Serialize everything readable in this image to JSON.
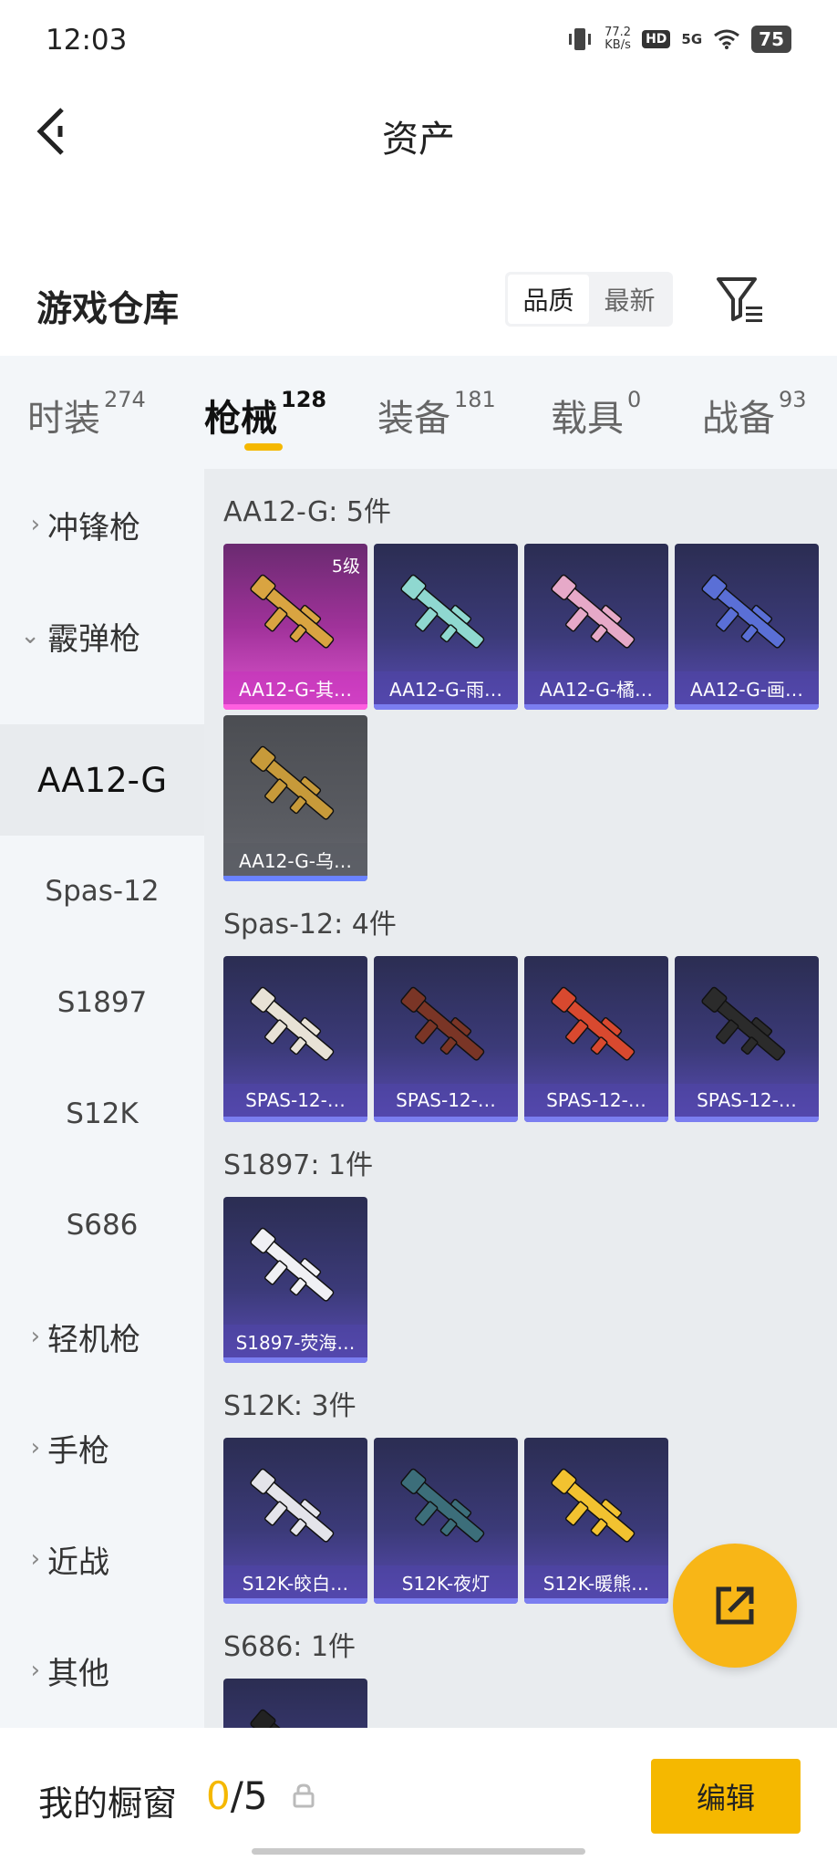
{
  "status_bar": {
    "time": "12:03",
    "net_speed": "77.2",
    "net_unit": "KB/s",
    "hd": "HD",
    "signal": "5G",
    "battery": "75"
  },
  "header": {
    "title": "资产"
  },
  "section": {
    "title": "游戏仓库",
    "sort_options": [
      "品质",
      "最新"
    ],
    "active_sort": "品质"
  },
  "tabs": [
    {
      "label": "时装",
      "count": "274"
    },
    {
      "label": "枪械",
      "count": "128"
    },
    {
      "label": "装备",
      "count": "181"
    },
    {
      "label": "载具",
      "count": "0"
    },
    {
      "label": "战备",
      "count": "93"
    }
  ],
  "sidebar": {
    "items": [
      {
        "label": "冲锋枪",
        "chevron": "›"
      },
      {
        "label": "霰弹枪",
        "chevron": "⌄"
      },
      {
        "label": "AA12-G"
      },
      {
        "label": "Spas-12"
      },
      {
        "label": "S1897"
      },
      {
        "label": "S12K"
      },
      {
        "label": "S686"
      },
      {
        "label": "轻机枪",
        "chevron": "›"
      },
      {
        "label": "手枪",
        "chevron": "›"
      },
      {
        "label": "近战",
        "chevron": "›"
      },
      {
        "label": "其他",
        "chevron": "›"
      }
    ]
  },
  "groups": [
    {
      "title": "AA12-G: 5件",
      "cards": [
        {
          "name": "AA12-G-其…",
          "level": "5级",
          "style": "pink",
          "gun_color": "#d9a441"
        },
        {
          "name": "AA12-G-雨…",
          "style": "blue",
          "gun_color": "#8fd8d0"
        },
        {
          "name": "AA12-G-橘…",
          "style": "blue",
          "gun_color": "#e6a9c8"
        },
        {
          "name": "AA12-G-画…",
          "style": "blue",
          "gun_color": "#5a6fd6"
        },
        {
          "name": "AA12-G-乌…",
          "style": "gray",
          "gun_color": "#c79a3a"
        }
      ]
    },
    {
      "title": "Spas-12: 4件",
      "cards": [
        {
          "name": "SPAS-12-…",
          "style": "blue",
          "gun_color": "#e8e2d6"
        },
        {
          "name": "SPAS-12-…",
          "style": "blue",
          "gun_color": "#7a3526"
        },
        {
          "name": "SPAS-12-…",
          "style": "blue",
          "gun_color": "#d8492f"
        },
        {
          "name": "SPAS-12-…",
          "style": "blue",
          "gun_color": "#2b2b2b"
        }
      ]
    },
    {
      "title": "S1897: 1件",
      "cards": [
        {
          "name": "S1897-荧海…",
          "style": "blue",
          "gun_color": "#f0f0f4"
        }
      ]
    },
    {
      "title": "S12K: 3件",
      "cards": [
        {
          "name": "S12K-皎白…",
          "style": "blue",
          "gun_color": "#e4e4ea"
        },
        {
          "name": "S12K-夜灯",
          "style": "blue",
          "gun_color": "#3c6e7a"
        },
        {
          "name": "S12K-暖熊…",
          "style": "blue",
          "gun_color": "#f2c230"
        }
      ]
    },
    {
      "title": "S686: 1件",
      "cards": [
        {
          "name": "",
          "style": "blue",
          "gun_color": "#222222"
        }
      ]
    }
  ],
  "bottom_bar": {
    "label": "我的橱窗",
    "count_current": "0",
    "count_total": "/5",
    "edit_label": "编辑"
  }
}
